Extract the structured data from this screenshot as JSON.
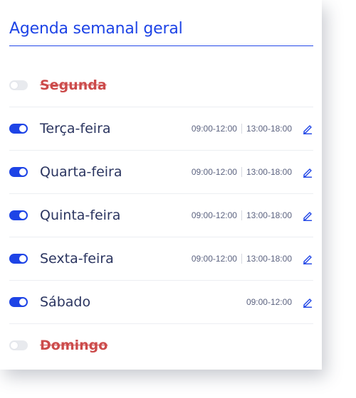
{
  "title": "Agenda semanal geral",
  "accent_color": "#1e44e6",
  "disabled_color": "#cc4b4b",
  "days": [
    {
      "label": "Segunda",
      "enabled": false,
      "slots": []
    },
    {
      "label": "Terça-feira",
      "enabled": true,
      "slots": [
        "09:00-12:00",
        "13:00-18:00"
      ]
    },
    {
      "label": "Quarta-feira",
      "enabled": true,
      "slots": [
        "09:00-12:00",
        "13:00-18:00"
      ]
    },
    {
      "label": "Quinta-feira",
      "enabled": true,
      "slots": [
        "09:00-12:00",
        "13:00-18:00"
      ]
    },
    {
      "label": "Sexta-feira",
      "enabled": true,
      "slots": [
        "09:00-12:00",
        "13:00-18:00"
      ]
    },
    {
      "label": "Sábado",
      "enabled": true,
      "slots": [
        "09:00-12:00"
      ]
    },
    {
      "label": "Domingo",
      "enabled": false,
      "slots": []
    }
  ],
  "edit_icon": "pencil-icon"
}
